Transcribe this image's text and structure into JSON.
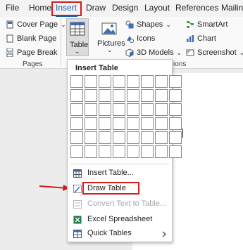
{
  "menubar": {
    "tabs": [
      "File",
      "Home",
      "Insert",
      "Draw",
      "Design",
      "Layout",
      "References",
      "Mailing"
    ],
    "active": "Insert"
  },
  "ribbon": {
    "pages": {
      "cover_page": "Cover Page",
      "blank_page": "Blank Page",
      "page_break": "Page Break",
      "group_label": "Pages"
    },
    "table": {
      "label": "Table"
    },
    "illustrations": {
      "pictures": "Pictures",
      "shapes": "Shapes",
      "icons": "Icons",
      "models_3d": "3D Models",
      "smartart": "SmartArt",
      "chart": "Chart",
      "screenshot": "Screenshot",
      "group_label_partial": "ions"
    },
    "chevron": "⌄"
  },
  "dropdown": {
    "title": "Insert Table",
    "grid": {
      "columns": 8,
      "rows": 6
    },
    "items": [
      {
        "label": "Insert Table...",
        "enabled": true,
        "icon": "insert-table-icon"
      },
      {
        "label": "Draw Table",
        "enabled": true,
        "icon": "draw-table-icon",
        "highlighted": true
      },
      {
        "label": "Convert Text to Table...",
        "enabled": false,
        "icon": "convert-text-icon"
      },
      {
        "label": "Excel Spreadsheet",
        "enabled": true,
        "icon": "excel-icon"
      },
      {
        "label": "Quick Tables",
        "enabled": true,
        "icon": "quick-tables-icon",
        "submenu": true
      }
    ]
  },
  "colors": {
    "accent": "#1f5fa8",
    "highlight_red": "#d21b1b"
  }
}
